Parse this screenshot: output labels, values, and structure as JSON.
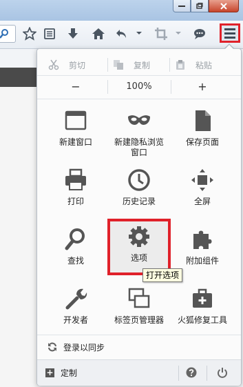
{
  "panel": {
    "edit": {
      "cut": "剪切",
      "copy": "复制",
      "paste": "粘贴"
    },
    "zoom": {
      "minus": "−",
      "level": "100%",
      "plus": "+"
    },
    "items": [
      {
        "label": "新建窗口"
      },
      {
        "label": "新建隐私浏览\n窗口"
      },
      {
        "label": "保存页面"
      },
      {
        "label": "打印"
      },
      {
        "label": "历史记录"
      },
      {
        "label": "全屏"
      },
      {
        "label": "查找"
      },
      {
        "label": "选项"
      },
      {
        "label": "附加组件"
      },
      {
        "label": "开发者"
      },
      {
        "label": "标签页管理器"
      },
      {
        "label": "火狐修复工具"
      }
    ],
    "tooltip": "打开选项",
    "sync": "登录以同步",
    "customize": "定制"
  },
  "colors": {
    "highlight_border": "#e0212a"
  }
}
